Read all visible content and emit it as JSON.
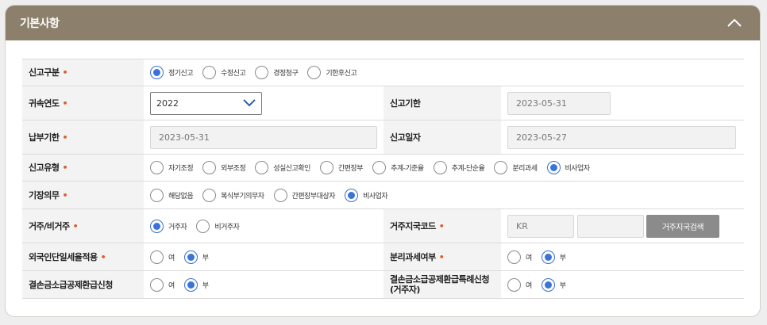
{
  "section": {
    "title": "기본사항"
  },
  "rows": {
    "report_type": {
      "label": "신고구분",
      "options": [
        "정기신고",
        "수정신고",
        "경정청구",
        "기한후신고"
      ],
      "selected": 0
    },
    "year": {
      "label": "귀속연도",
      "value": "2022"
    },
    "deadline": {
      "label": "신고기한",
      "value": "2023-05-31"
    },
    "pay_deadline": {
      "label": "납부기한",
      "value": "2023-05-31"
    },
    "report_date": {
      "label": "신고일자",
      "value": "2023-05-27"
    },
    "report_kind": {
      "label": "신고유형",
      "options": [
        "자기조정",
        "외부조정",
        "성실신고확인",
        "간편장부",
        "추계-기준율",
        "추계-단순율",
        "분리과세",
        "비사업자"
      ],
      "selected": 7
    },
    "bookkeeping": {
      "label": "기장의무",
      "options": [
        "해당없음",
        "복식부기의무자",
        "간편장부대상자",
        "비사업자"
      ],
      "selected": 3
    },
    "residency": {
      "label": "거주/비거주",
      "options": [
        "거주자",
        "비거주자"
      ],
      "selected": 0
    },
    "country": {
      "label": "거주지국코드",
      "value": "KR",
      "value2": "",
      "button": "거주지국검색"
    },
    "foreign_rate": {
      "label": "외국인단일세율적용",
      "options": [
        "여",
        "부"
      ],
      "selected": 1
    },
    "separate_tax": {
      "label": "분리과세여부",
      "options": [
        "여",
        "부"
      ],
      "selected": 1
    },
    "loss_refund": {
      "label": "결손금소급공제환급신청",
      "options": [
        "여",
        "부"
      ],
      "selected": 1
    },
    "loss_refund_special": {
      "label_line1": "결손금소급공제환급특례신청",
      "label_line2": "(거주자)",
      "options": [
        "여",
        "부"
      ],
      "selected": 1
    }
  },
  "required_mark": "•"
}
